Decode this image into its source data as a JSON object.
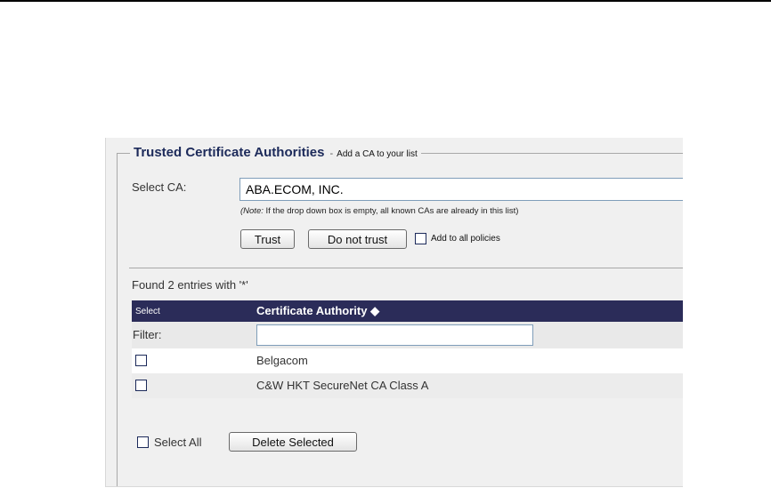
{
  "section": {
    "title": "Trusted Certificate Authorities",
    "separator": "-",
    "subtitle": "Add a CA to your list"
  },
  "select_ca": {
    "label": "Select CA:",
    "value": "ABA.ECOM, INC.",
    "note_prefix": "(Note:",
    "note_text": " If the drop down box is empty, all known CAs are already in this list)"
  },
  "actions": {
    "trust": "Trust",
    "do_not_trust": "Do not trust",
    "add_to_all": "Add to all policies"
  },
  "results": {
    "found_text": "Found 2 entries with '*'"
  },
  "table": {
    "col_select": "Select",
    "col_ca": "Certificate Authority ◆",
    "filter_label": "Filter:",
    "filter_value": "",
    "rows": [
      {
        "name": "Belgacom",
        "checked": false
      },
      {
        "name": "C&W HKT SecureNet CA Class A",
        "checked": false
      }
    ]
  },
  "footer": {
    "select_all": "Select All",
    "delete_selected": "Delete Selected"
  }
}
